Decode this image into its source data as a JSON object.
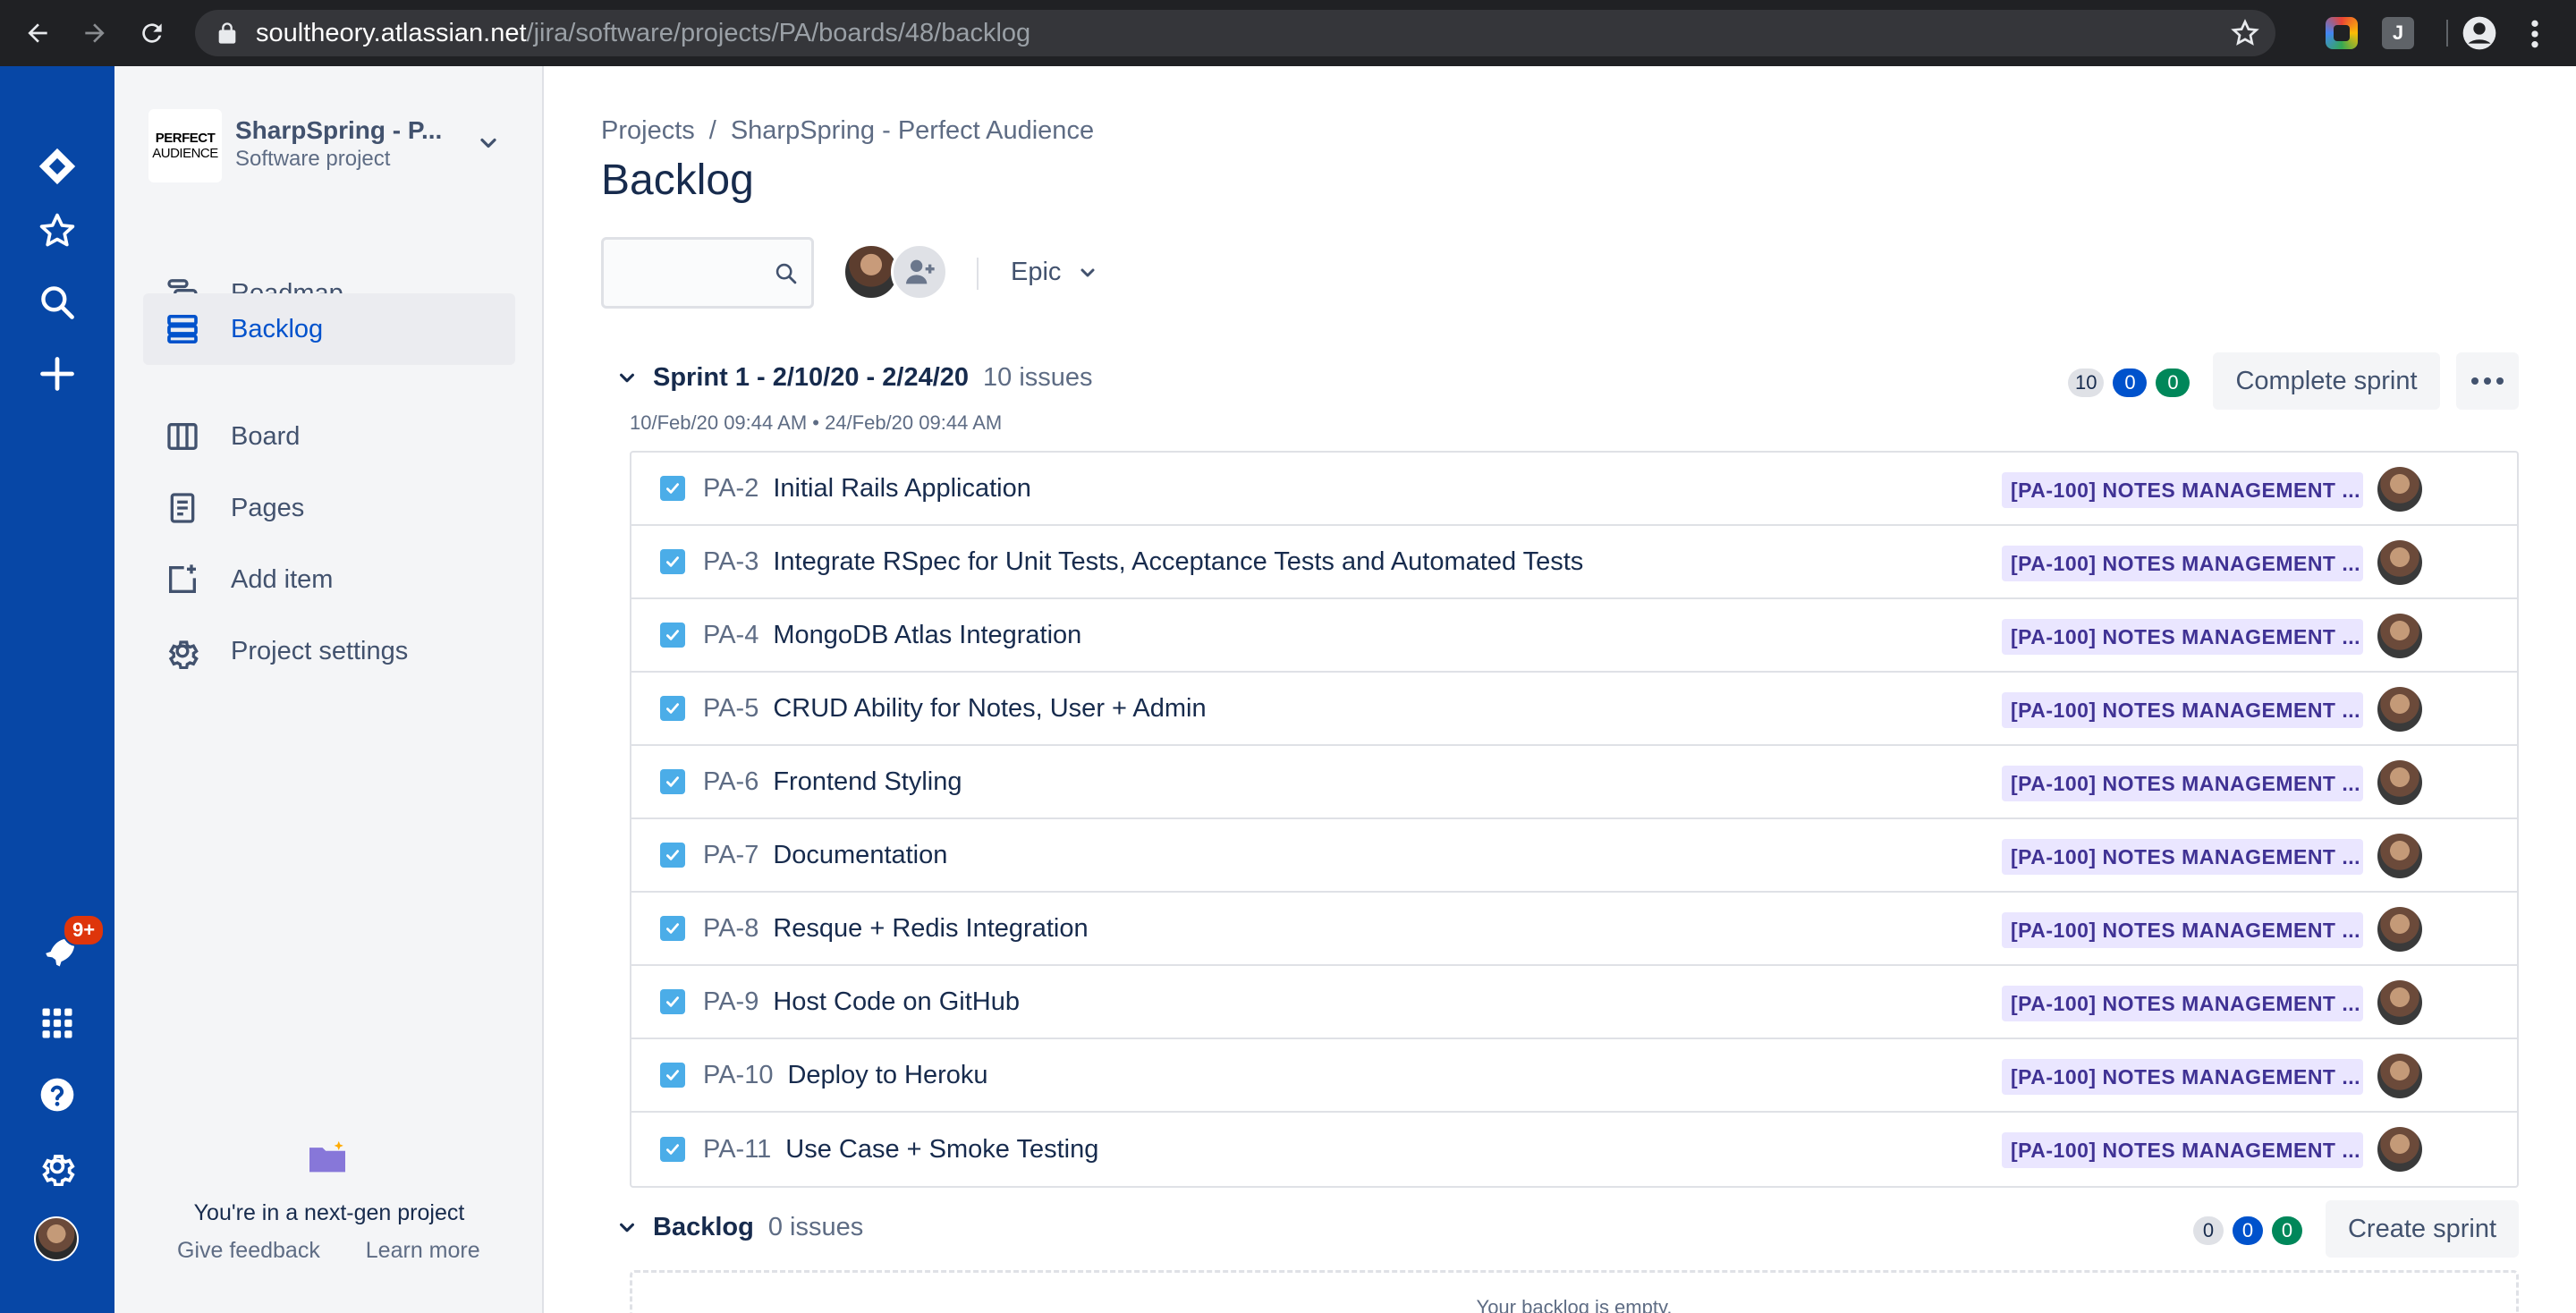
{
  "browser": {
    "url_host": "soultheory.atlassian.net",
    "url_path": "/jira/software/projects/PA/boards/48/backlog",
    "ext_j_label": "J"
  },
  "global_nav": {
    "notifications_badge": "9+"
  },
  "project": {
    "logo_line1": "PERFECT",
    "logo_line2": "AUDIENCE",
    "name": "SharpSpring - P...",
    "type": "Software project"
  },
  "sidebar": {
    "items": [
      {
        "label": "Roadmap",
        "icon": "roadmap-icon"
      },
      {
        "label": "Backlog",
        "icon": "backlog-icon",
        "active": true
      },
      {
        "label": "Board",
        "icon": "board-icon"
      },
      {
        "label": "Pages",
        "icon": "pages-icon"
      },
      {
        "label": "Add item",
        "icon": "add-item-icon"
      },
      {
        "label": "Project settings",
        "icon": "gear-icon"
      }
    ],
    "next_gen_text": "You're in a next-gen project",
    "give_feedback": "Give feedback",
    "learn_more": "Learn more"
  },
  "breadcrumb": {
    "projects": "Projects",
    "separator": "/",
    "project": "SharpSpring - Perfect Audience"
  },
  "page_title": "Backlog",
  "toolbar": {
    "epic_filter": "Epic"
  },
  "sprint": {
    "name": "Sprint 1 - 2/10/20 - 2/24/20",
    "issue_count": "10 issues",
    "dates": "10/Feb/20 09:44 AM • 24/Feb/20 09:44 AM",
    "todo": "10",
    "in_progress": "0",
    "done": "0",
    "complete_button": "Complete sprint",
    "issues": [
      {
        "key": "PA-2",
        "summary": "Initial Rails Application",
        "epic": "[PA-100] NOTES MANAGEMENT ..."
      },
      {
        "key": "PA-3",
        "summary": "Integrate RSpec for Unit Tests, Acceptance Tests and Automated Tests",
        "epic": "[PA-100] NOTES MANAGEMENT ..."
      },
      {
        "key": "PA-4",
        "summary": "MongoDB Atlas Integration",
        "epic": "[PA-100] NOTES MANAGEMENT ..."
      },
      {
        "key": "PA-5",
        "summary": "CRUD Ability for Notes, User + Admin",
        "epic": "[PA-100] NOTES MANAGEMENT ..."
      },
      {
        "key": "PA-6",
        "summary": "Frontend Styling",
        "epic": "[PA-100] NOTES MANAGEMENT ..."
      },
      {
        "key": "PA-7",
        "summary": "Documentation",
        "epic": "[PA-100] NOTES MANAGEMENT ..."
      },
      {
        "key": "PA-8",
        "summary": "Resque + Redis Integration",
        "epic": "[PA-100] NOTES MANAGEMENT ..."
      },
      {
        "key": "PA-9",
        "summary": "Host Code on GitHub",
        "epic": "[PA-100] NOTES MANAGEMENT ..."
      },
      {
        "key": "PA-10",
        "summary": "Deploy to Heroku",
        "epic": "[PA-100] NOTES MANAGEMENT ..."
      },
      {
        "key": "PA-11",
        "summary": "Use Case + Smoke Testing",
        "epic": "[PA-100] NOTES MANAGEMENT ..."
      }
    ]
  },
  "backlog": {
    "name": "Backlog",
    "issue_count": "0 issues",
    "todo": "0",
    "in_progress": "0",
    "done": "0",
    "create_button": "Create sprint",
    "empty_text": "Your backlog is empty."
  },
  "colors": {
    "global_nav": "#0747A6",
    "link_active": "#0052CC",
    "epic_bg": "#EAE6FF",
    "epic_text": "#403294"
  }
}
